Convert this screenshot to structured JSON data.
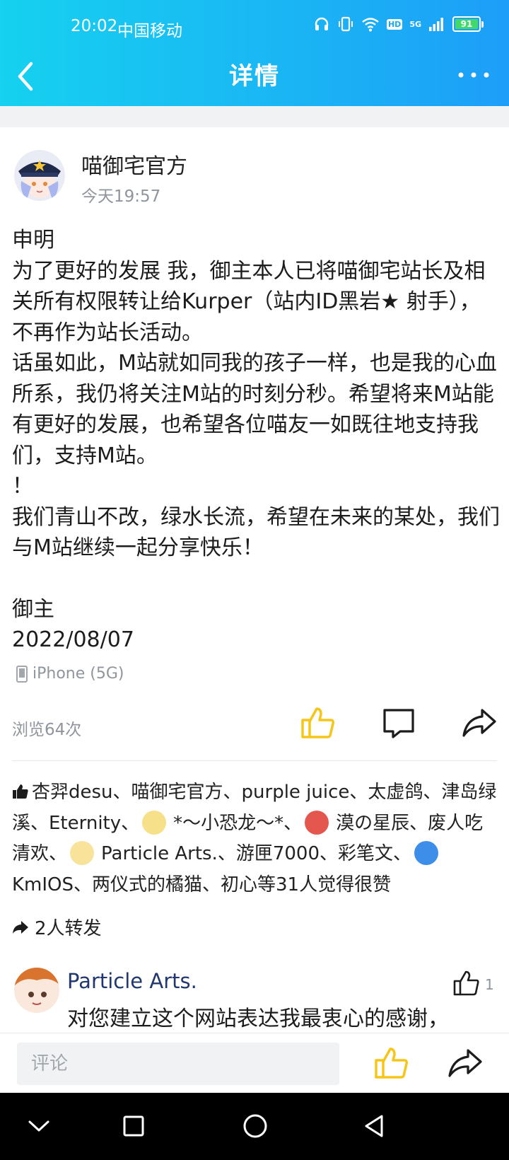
{
  "status_bar": {
    "time": "20:02",
    "carrier": "中国移动",
    "network_badge": "HD",
    "signal_type": "5G",
    "battery": "91",
    "icons": [
      "headphones-icon",
      "vibrate-icon",
      "wifi-icon",
      "signal-icon",
      "battery-icon"
    ]
  },
  "header": {
    "title": "详情",
    "back_icon": "chevron-left-icon",
    "more_icon": "more-horizontal-icon"
  },
  "post": {
    "author": "喵御宅官方",
    "time": "今天19:57",
    "body": [
      "申明",
      "为了更好的发展 我，御主本人已将喵御宅站长及相关所有权限转让给Kurper（站内ID黑岩★ 射手），不再作为站长活动。",
      "话虽如此，M站就如同我的孩子一样，也是我的心血所系，我仍将关注M站的时刻分秒。希望将来M站能有更好的发展，也希望各位喵友一如既往地支持我们，支持M站。",
      "！",
      "我们青山不改，绿水长流，希望在未来的某处，我们与M站继续一起分享快乐！"
    ],
    "signature": "御主",
    "date": "2022/08/07",
    "device": "iPhone (5G)",
    "views": "浏览64次"
  },
  "likes": {
    "part1": "杏羿desu、喵御宅官方、purple juice、太虚鸽、津岛绿溪、Eternity、",
    "part2": "*～小恐龙～*、",
    "part3": "漠の星辰、废人吃清欢、",
    "part4": "Particle Arts.、游匣7000、彩笔文、",
    "part5": "KmIOS、两仪式的橘猫、初心等31人觉得很赞"
  },
  "reposts": "2人转发",
  "comment": {
    "author": "Particle Arts.",
    "text": "对您建立这个网站表达我最衷心的感谢，",
    "like_count": "1"
  },
  "input": {
    "placeholder": "评论"
  },
  "colors": {
    "header_gradient_start": "#16d1f0",
    "header_gradient_end": "#1d9ef8",
    "like_accent": "#f5c518",
    "comment_name": "#20386f",
    "muted_text": "#8f959c"
  }
}
